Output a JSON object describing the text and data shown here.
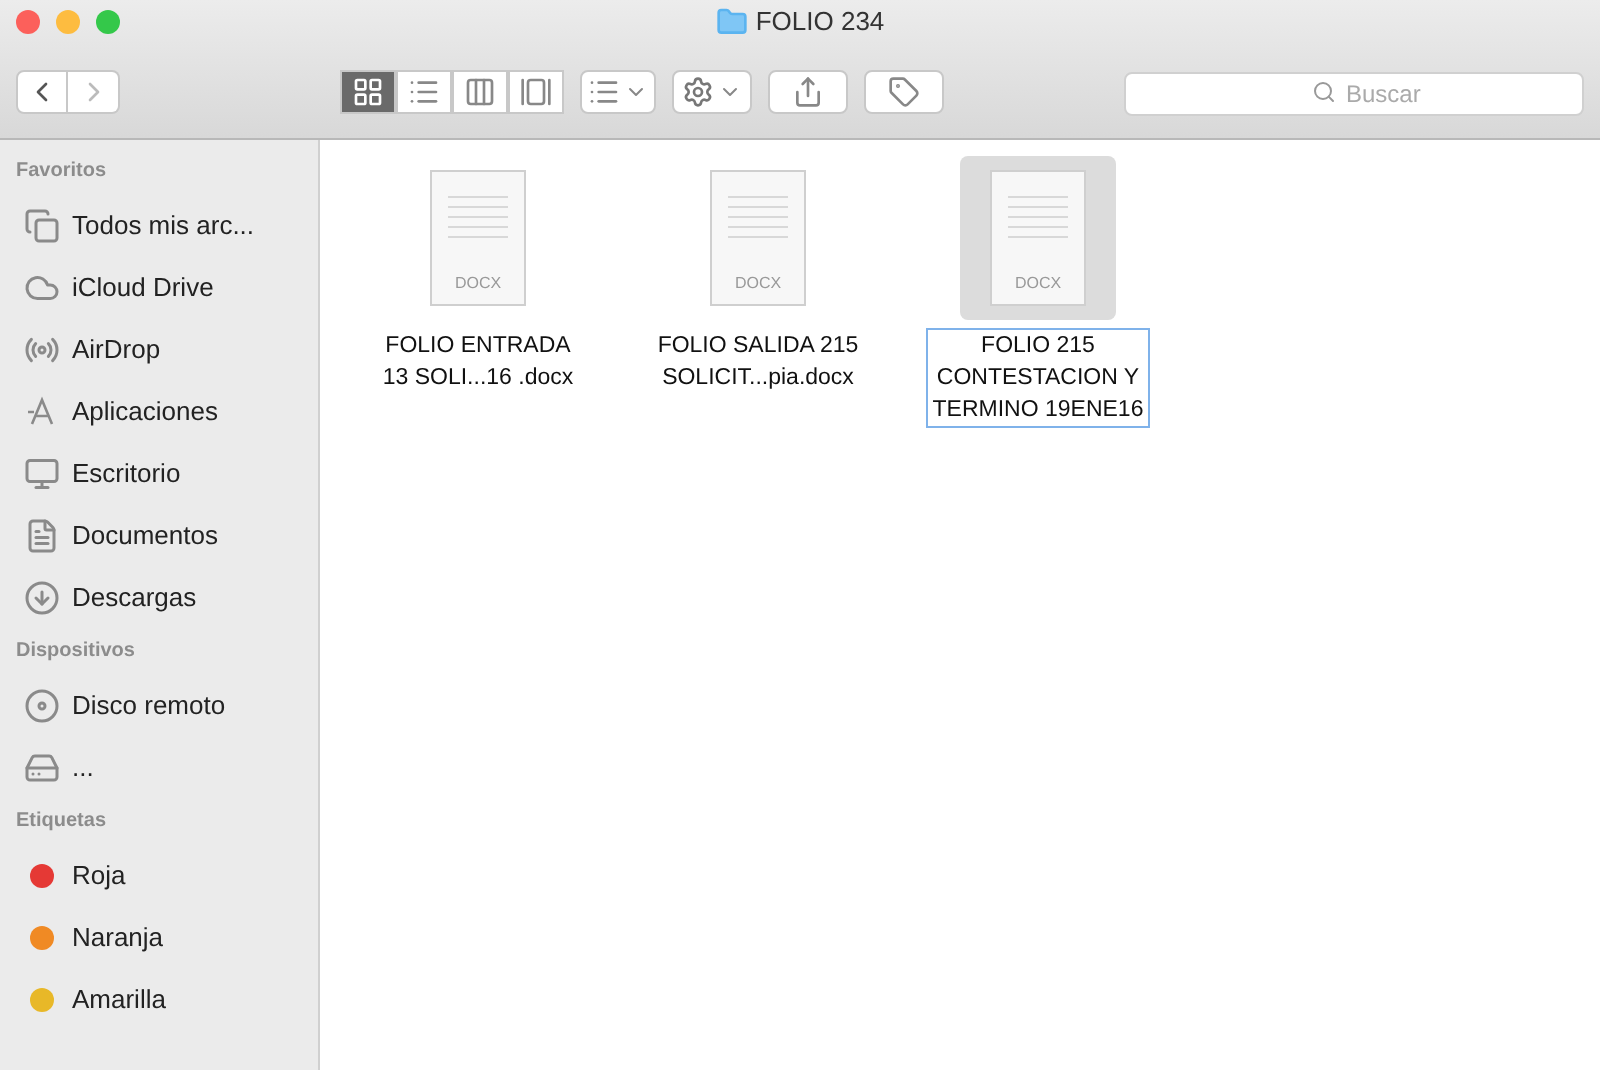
{
  "window": {
    "title": "FOLIO 234"
  },
  "toolbar": {
    "view_buttons": [
      {
        "kind": "icons",
        "selected": true
      },
      {
        "kind": "list",
        "selected": false
      },
      {
        "kind": "columns",
        "selected": false
      },
      {
        "kind": "cover",
        "selected": false
      }
    ],
    "search": {
      "placeholder": "Buscar"
    }
  },
  "sidebar": {
    "sections": [
      {
        "title": "Favoritos",
        "items": [
          {
            "label": "Todos mis arc...",
            "kind": "all"
          },
          {
            "label": "iCloud Drive",
            "kind": "cloud"
          },
          {
            "label": "AirDrop",
            "kind": "airdrop"
          },
          {
            "label": "Aplicaciones",
            "kind": "apps"
          },
          {
            "label": "Escritorio",
            "kind": "desktop"
          },
          {
            "label": "Documentos",
            "kind": "docs"
          },
          {
            "label": "Descargas",
            "kind": "downloads"
          }
        ]
      },
      {
        "title": "Dispositivos",
        "items": [
          {
            "label": "Disco remoto",
            "kind": "disc"
          },
          {
            "label": "...",
            "kind": "drive"
          }
        ]
      },
      {
        "title": "Etiquetas",
        "items": [
          {
            "label": "Roja",
            "kind": "tag",
            "color": "#e53935"
          },
          {
            "label": "Naranja",
            "kind": "tag",
            "color": "#f08a24"
          },
          {
            "label": "Amarilla",
            "kind": "tag",
            "color": "#e8b828"
          }
        ]
      }
    ]
  },
  "files": [
    {
      "badge": "DOCX",
      "name": "FOLIO ENTRADA 13 SOLI...16 .docx",
      "selected": false
    },
    {
      "badge": "DOCX",
      "name": "FOLIO SALIDA 215 SOLICIT...pia.docx",
      "selected": false
    },
    {
      "badge": "DOCX",
      "name": "FOLIO 215 CONTESTACION Y TERMINO 19ENE16",
      "selected": true
    }
  ]
}
